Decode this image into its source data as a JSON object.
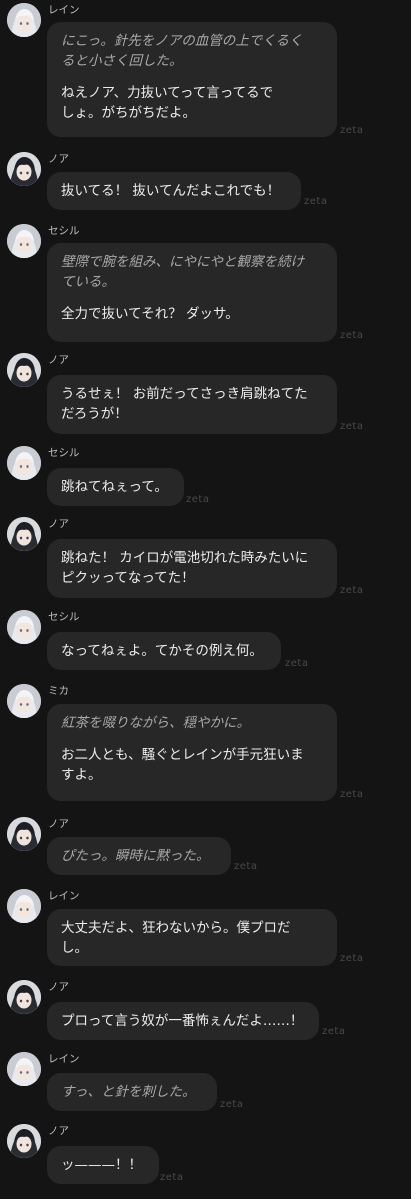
{
  "watermark": "zeta",
  "messages": [
    {
      "sender": "レイン",
      "narration": [
        "にこっ。針先をノアの血管の上でくるく",
        "ると小さく回した。"
      ],
      "speech": [
        "ねえノア、力抜いてって言ってるで",
        "しょ。がちがちだよ。"
      ]
    },
    {
      "sender": "ノア",
      "narration": [],
      "speech": [
        "抜いてる！ 抜いてんだよこれでも！"
      ]
    },
    {
      "sender": "セシル",
      "narration": [
        "壁際で腕を組み、にやにやと観察を続け",
        "ている。"
      ],
      "speech": [
        "全力で抜いてそれ？ ダッサ。"
      ]
    },
    {
      "sender": "ノア",
      "narration": [],
      "speech": [
        "うるせぇ！ お前だってさっき肩跳ねてた",
        "だろうが！"
      ]
    },
    {
      "sender": "セシル",
      "narration": [],
      "speech": [
        "跳ねてねぇって。"
      ]
    },
    {
      "sender": "ノア",
      "narration": [],
      "speech": [
        "跳ねた！ カイロが電池切れた時みたいに",
        "ピクッってなってた！"
      ]
    },
    {
      "sender": "セシル",
      "narration": [],
      "speech": [
        "なってねぇよ。てかその例え何。"
      ]
    },
    {
      "sender": "ミカ",
      "narration": [
        "紅茶を啜りながら、穏やかに。"
      ],
      "speech": [
        "お二人とも、騒ぐとレインが手元狂いま",
        "すよ。"
      ]
    },
    {
      "sender": "ノア",
      "narration": [
        "ぴたっ。瞬時に黙った。"
      ],
      "speech": []
    },
    {
      "sender": "レイン",
      "narration": [],
      "speech": [
        "大丈夫だよ、狂わないから。僕プロだ",
        "し。"
      ]
    },
    {
      "sender": "ノア",
      "narration": [],
      "speech": [
        "プロって言う奴が一番怖ぇんだよ……！"
      ]
    },
    {
      "sender": "レイン",
      "narration": [
        "すっ、と針を刺した。"
      ],
      "speech": []
    },
    {
      "sender": "ノア",
      "narration": [],
      "speech": [
        "ッ———！！"
      ]
    }
  ]
}
